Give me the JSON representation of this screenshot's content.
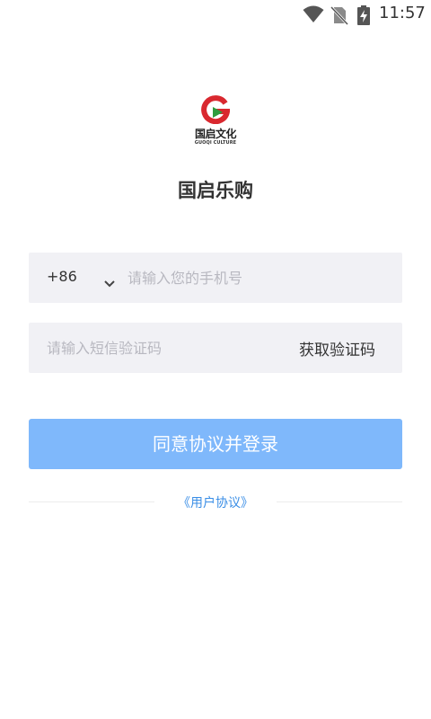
{
  "status_bar": {
    "time": "11:57",
    "icons": [
      "wifi-icon",
      "no-sim-icon",
      "battery-charging-icon"
    ]
  },
  "logo": {
    "name_cn": "国启文化",
    "name_en": "GUOQI CULTURE",
    "colors": {
      "red": "#d9282f",
      "green": "#2e9b3e"
    }
  },
  "app_title": "国启乐购",
  "phone": {
    "country_code": "+86",
    "placeholder": "请输入您的手机号"
  },
  "verification": {
    "placeholder": "请输入短信验证码",
    "get_code_label": "获取验证码"
  },
  "login_button_label": "同意协议并登录",
  "agreement_link": "《用户协议》",
  "colors": {
    "primary_button": "#7fb8fb",
    "link": "#3a8ee6",
    "input_background": "#f1f1f5"
  }
}
